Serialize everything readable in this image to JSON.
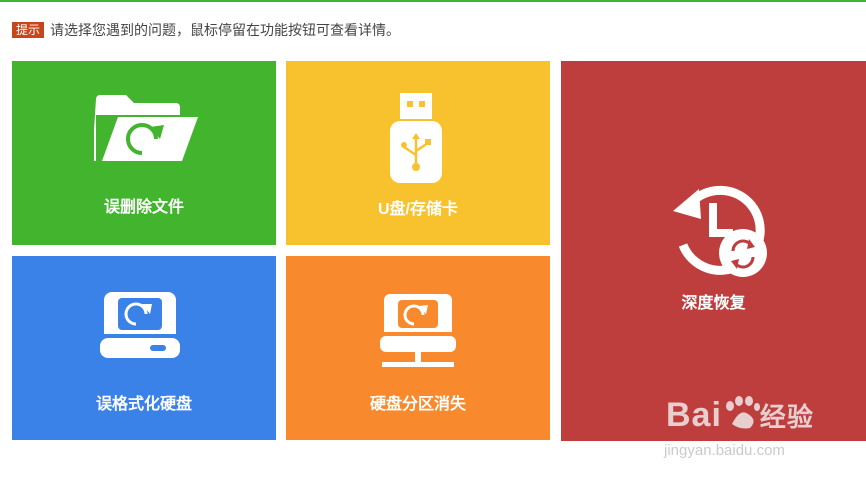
{
  "hint": {
    "badge": "提示",
    "text": "请选择您遇到的问题，鼠标停留在功能按钮可查看详情。"
  },
  "tiles": {
    "delete": {
      "label": "误删除文件",
      "color": "#43b42e",
      "icon": "folder-refresh-icon"
    },
    "usb": {
      "label": "U盘/存储卡",
      "color": "#f8c22e",
      "icon": "usb-drive-icon"
    },
    "deep": {
      "label": "深度恢复",
      "color": "#be3e3e",
      "icon": "history-clock-icon"
    },
    "format": {
      "label": "误格式化硬盘",
      "color": "#3b82e8",
      "icon": "hard-drive-refresh-icon"
    },
    "lost": {
      "label": "硬盘分区消失",
      "color": "#f88a2d",
      "icon": "network-drive-refresh-icon"
    }
  },
  "watermark": {
    "brand": "Bai",
    "brand_suffix": "经验",
    "site": "jingyan.baidu.com"
  }
}
